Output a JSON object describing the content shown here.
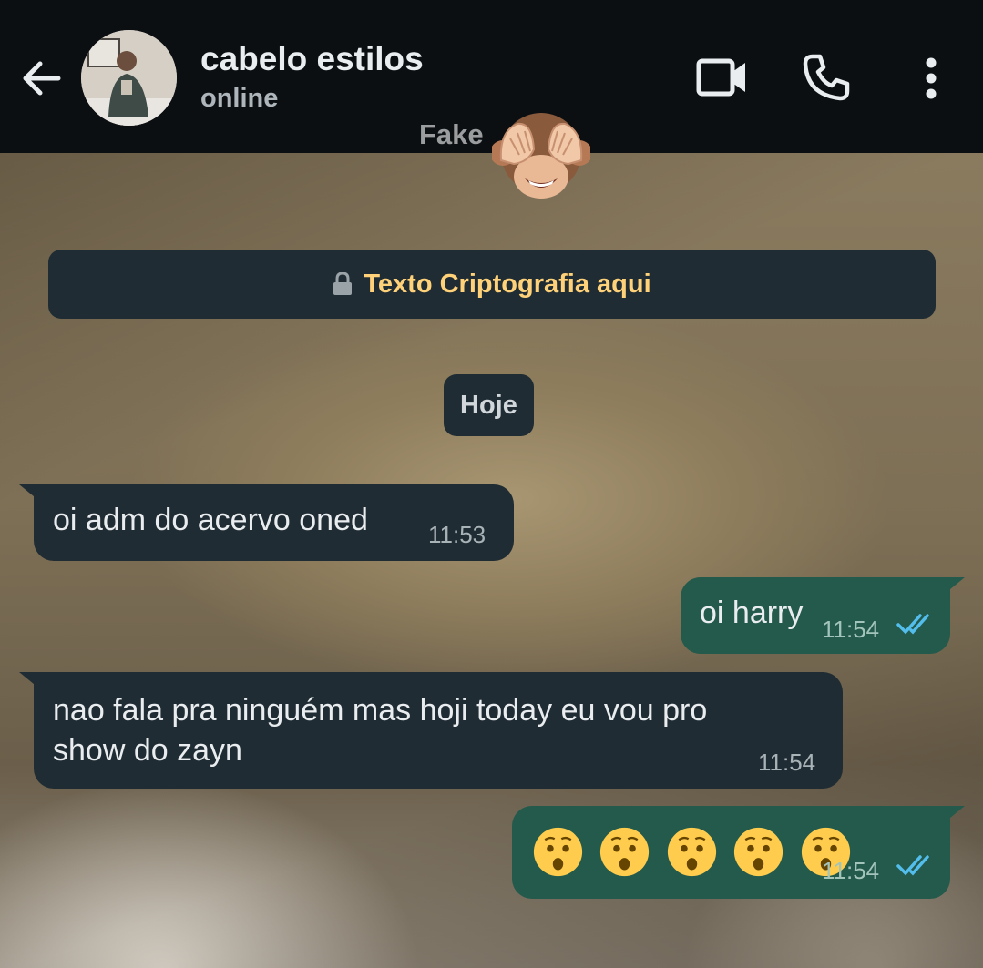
{
  "header": {
    "contact_name": "cabelo estilos",
    "status": "online",
    "icons": [
      "back-arrow-icon",
      "video-call-icon",
      "phone-icon",
      "more-options-icon"
    ]
  },
  "watermark": {
    "text": "Fake",
    "emoji": "see-no-evil-monkey"
  },
  "encryption_notice": {
    "text": "Texto Criptografia aqui",
    "icon": "lock-icon",
    "color": "#ffd279"
  },
  "date_chip": "Hoje",
  "messages": [
    {
      "direction": "in",
      "text": "oi adm do acervo oned",
      "time": "11:53"
    },
    {
      "direction": "out",
      "text": "oi harry",
      "time": "11:54",
      "status": "read"
    },
    {
      "direction": "in",
      "text": "nao fala pra ninguém mas hoji today eu vou pro show do zayn",
      "time": "11:54"
    },
    {
      "direction": "out",
      "emoji": [
        "hushed-face",
        "hushed-face",
        "hushed-face",
        "hushed-face",
        "hushed-face"
      ],
      "time": "11:54",
      "status": "read"
    }
  ],
  "colors": {
    "header_bg": "#0b0f12",
    "incoming_bubble": "#202c33",
    "outgoing_bubble": "#235a4b",
    "read_ticks": "#53bdeb"
  }
}
